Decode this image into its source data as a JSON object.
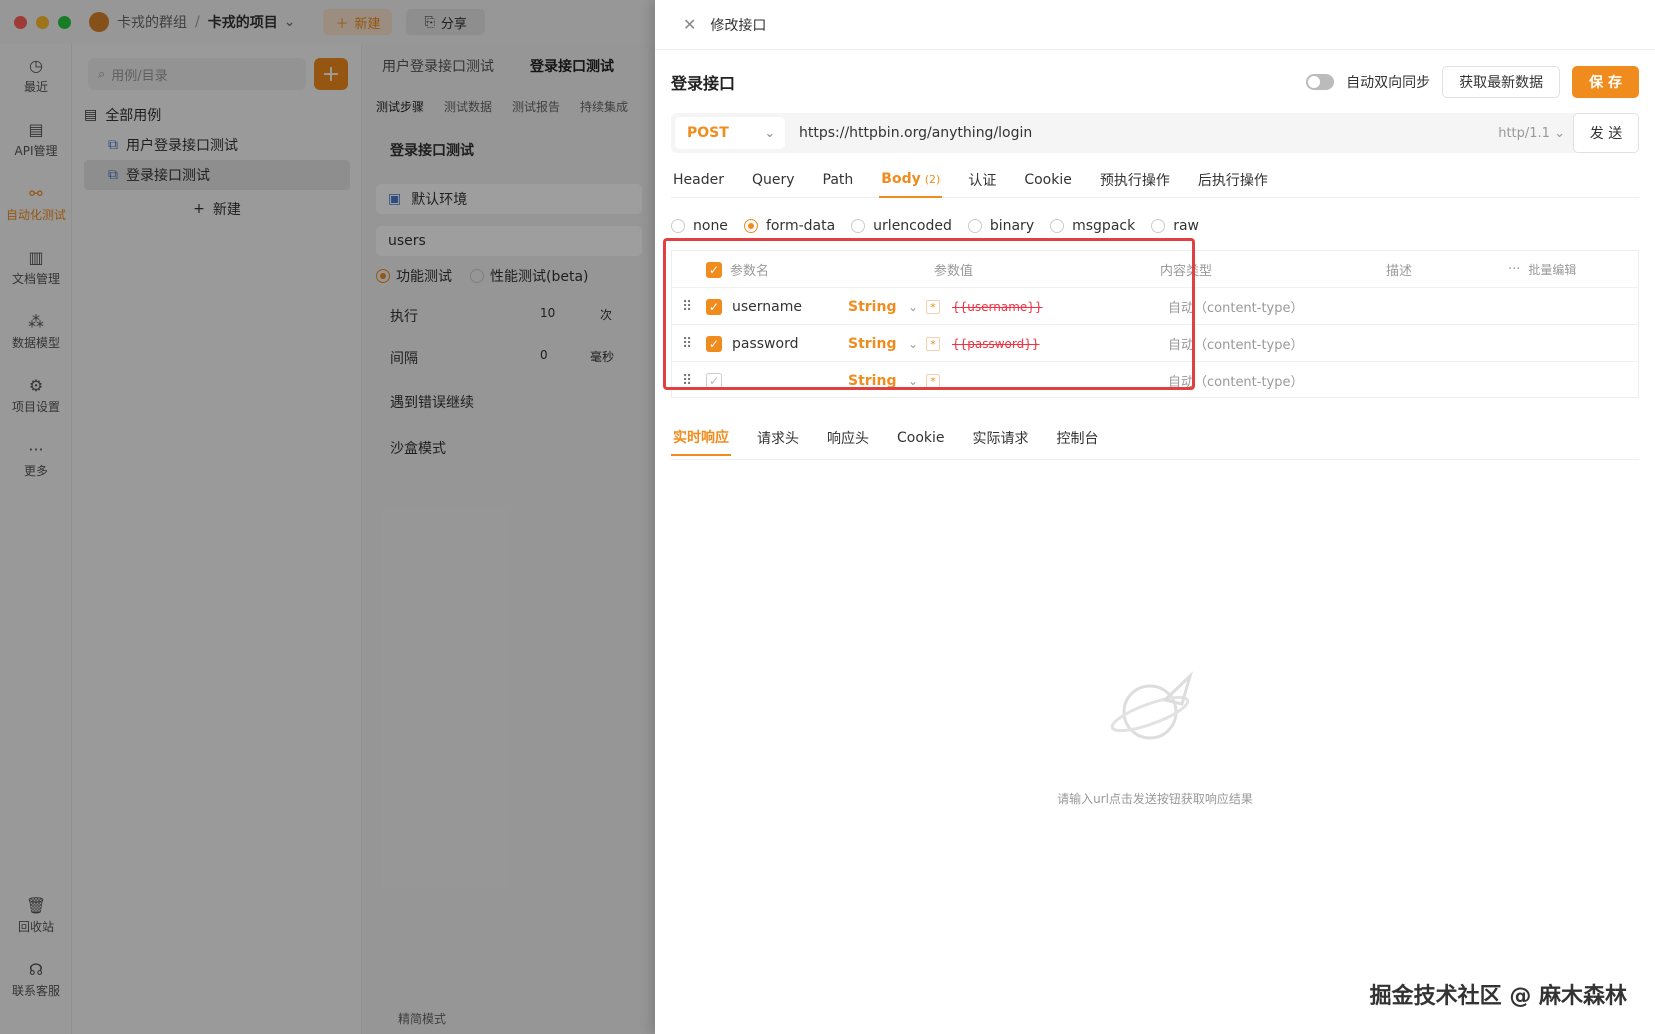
{
  "titlebar": {
    "group": "卡戎的群组",
    "separator": "/",
    "project": "卡戎的项目",
    "new_label": "新建",
    "share_label": "分享"
  },
  "nav": [
    {
      "label": "最近",
      "icon": "clock-icon"
    },
    {
      "label": "API管理",
      "icon": "api-icon"
    },
    {
      "label": "自动化测试",
      "icon": "automation-icon"
    },
    {
      "label": "文档管理",
      "icon": "document-icon"
    },
    {
      "label": "数据模型",
      "icon": "model-icon"
    },
    {
      "label": "项目设置",
      "icon": "settings-icon"
    },
    {
      "label": "更多",
      "icon": "more-icon"
    },
    {
      "label": "回收站",
      "icon": "trash-icon"
    },
    {
      "label": "联系客服",
      "icon": "headset-icon"
    }
  ],
  "tree": {
    "search_placeholder": "用例/目录",
    "root": "全部用例",
    "items": [
      "用户登录接口测试",
      "登录接口测试"
    ],
    "new_label": "新建"
  },
  "middle": {
    "tabs": [
      "用户登录接口测试",
      "登录接口测试"
    ],
    "subtabs": [
      "测试步骤",
      "测试数据",
      "测试报告",
      "持续集成"
    ],
    "title": "登录接口测试",
    "env": "默认环境",
    "dataset": "users",
    "mode_functional": "功能测试",
    "mode_perf": "性能测试(beta)",
    "run_label": "执行",
    "run_value": "10",
    "run_unit": "次",
    "interval_label": "间隔",
    "interval_value": "0",
    "interval_unit": "毫秒",
    "on_error": "遇到错误继续",
    "sandbox": "沙盒模式",
    "simple_mode": "精简模式"
  },
  "drawer": {
    "title": "修改接口",
    "api_name": "登录接口",
    "sync_label": "自动双向同步",
    "fetch_label": "获取最新数据",
    "save_label": "保 存",
    "method": "POST",
    "url": "https://httpbin.org/anything/login",
    "protocol": "http/1.1",
    "send_label": "发 送",
    "tabs": [
      "Header",
      "Query",
      "Path",
      "Body",
      "认证",
      "Cookie",
      "预执行操作",
      "后执行操作"
    ],
    "body_count": "(2)",
    "body_types": [
      "none",
      "form-data",
      "urlencoded",
      "binary",
      "msgpack",
      "raw"
    ],
    "table_headers": {
      "name": "参数名",
      "value": "参数值",
      "content_type": "内容类型",
      "desc": "描述",
      "batch": "批量编辑"
    },
    "params": [
      {
        "name": "username",
        "type": "String",
        "value": "{{username}}",
        "content_type": "自动（content-type）",
        "checked": true
      },
      {
        "name": "password",
        "type": "String",
        "value": "{{password}}",
        "content_type": "自动（content-type）",
        "checked": true
      },
      {
        "name": "",
        "type": "String",
        "value": "",
        "content_type": "自动（content-type）",
        "checked": false
      }
    ],
    "resp_tabs": [
      "实时响应",
      "请求头",
      "响应头",
      "Cookie",
      "实际请求",
      "控制台"
    ],
    "empty_text": "请输入url点击发送按钮获取响应结果"
  },
  "watermark": "掘金技术社区 @ 麻木森林",
  "colors": {
    "accent": "#f08c1e",
    "highlight": "#e04040"
  }
}
